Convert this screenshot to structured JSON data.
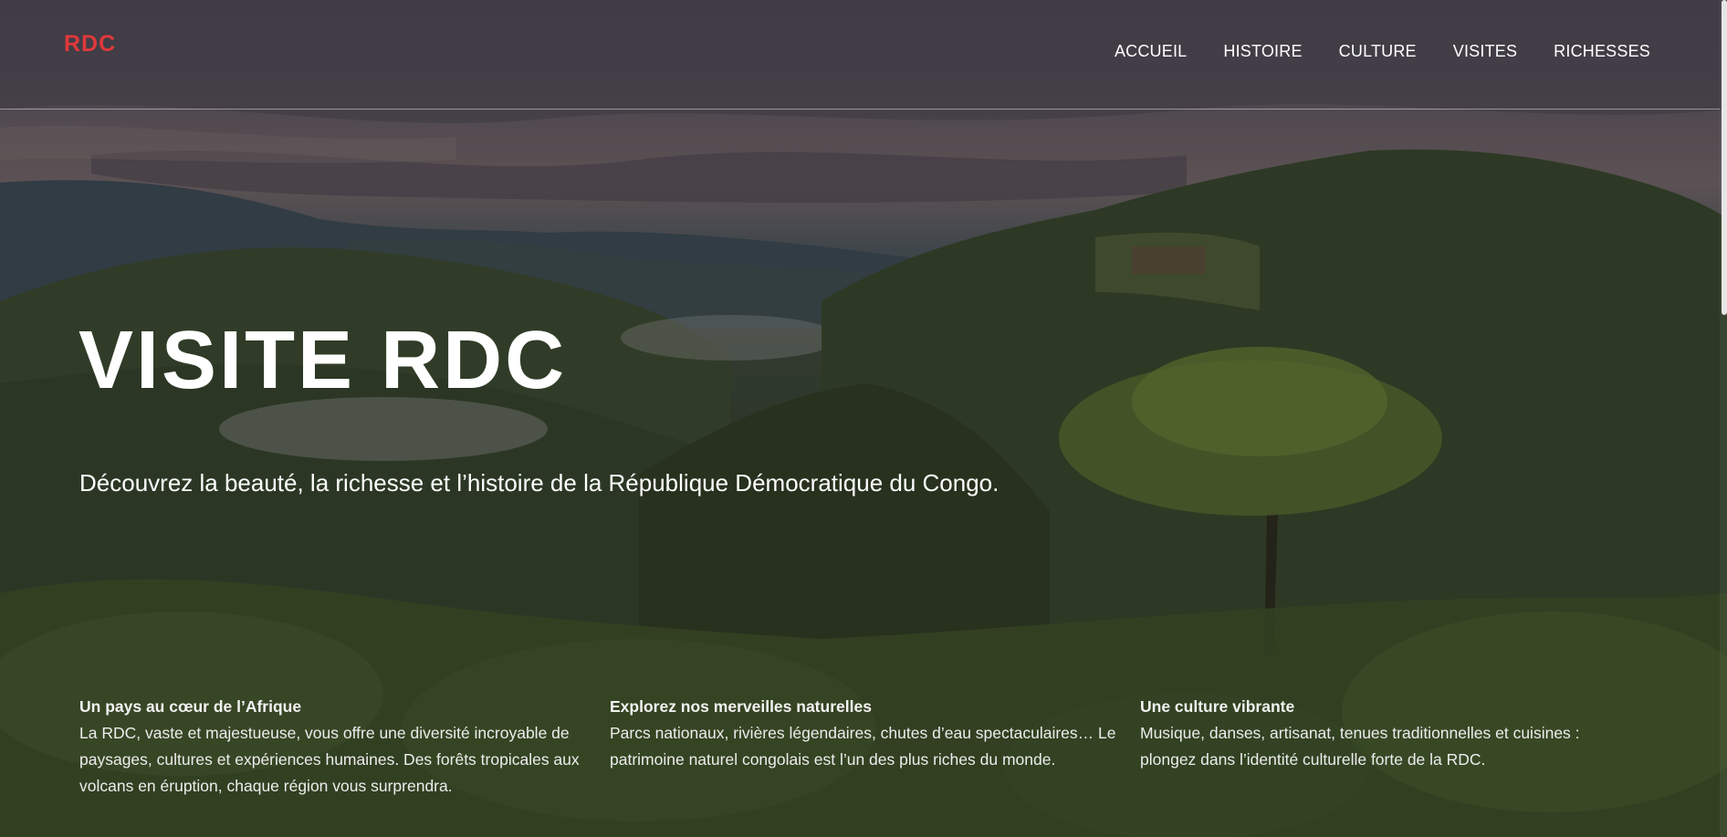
{
  "header": {
    "logo": "RDC",
    "nav": [
      "ACCUEIL",
      "HISTOIRE",
      "CULTURE",
      "VISITES",
      "RICHESSES"
    ]
  },
  "hero": {
    "title": "VISITE RDC",
    "subtitle": "Découvrez la beauté, la richesse et l’histoire de la République Démocratique du Congo."
  },
  "features": [
    {
      "title": "Un pays au cœur de l’Afrique",
      "text": "La RDC, vaste et majestueuse, vous offre une diversité incroyable de paysages, cultures et expériences humaines. Des forêts tropicales aux volcans en éruption, chaque région vous surprendra."
    },
    {
      "title": "Explorez nos merveilles naturelles",
      "text": "Parcs nationaux, rivières légendaires, chutes d’eau spectaculaires… Le patrimoine naturel congolais est l’un des plus riches du monde."
    },
    {
      "title": "Une culture vibrante",
      "text": "Musique, danses, artisanat, tenues traditionnelles et cuisines : plongez dans l’identité culturelle forte de la RDC."
    }
  ],
  "colors": {
    "logo": "#e0383b",
    "text": "#ffffff"
  }
}
